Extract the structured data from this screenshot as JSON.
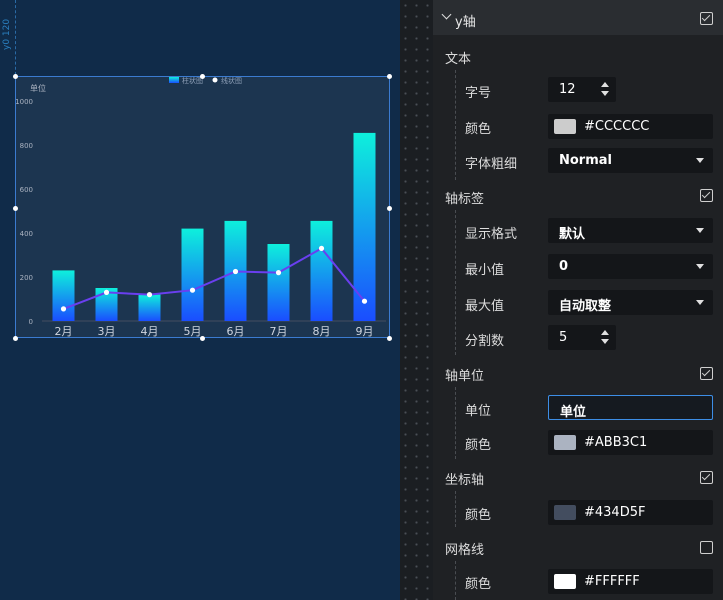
{
  "canvas": {
    "ruler_label": "y0 120"
  },
  "chart_data": {
    "type": "bar",
    "legend": [
      "柱状图",
      "线状图"
    ],
    "unit_label": "单位",
    "categories": [
      "2月",
      "3月",
      "4月",
      "5月",
      "6月",
      "7月",
      "8月",
      "9月"
    ],
    "series": [
      {
        "name": "柱状图",
        "type": "bar",
        "values": [
          230,
          150,
          120,
          420,
          455,
          350,
          455,
          855
        ]
      },
      {
        "name": "线状图",
        "type": "line",
        "values": [
          55,
          130,
          120,
          140,
          225,
          220,
          330,
          90
        ]
      }
    ],
    "yticks": [
      "0",
      "200",
      "400",
      "600",
      "800",
      "1000"
    ],
    "ylim": [
      0,
      1000
    ],
    "colors": {
      "bar_top": "#0ef0dc",
      "bar_bottom": "#1a4dff",
      "line": "#6a3ff0",
      "point": "#ffffff",
      "axis_text": "#ABB3C1"
    }
  },
  "panel": {
    "section_title": "y轴",
    "text_group": "文本",
    "font_size_label": "字号",
    "font_size_value": "12",
    "color_label": "颜色",
    "text_color": "#CCCCCC",
    "font_weight_label": "字体粗细",
    "font_weight_value": "Normal",
    "axis_label_group": "轴标签",
    "format_label": "显示格式",
    "format_value": "默认",
    "min_label": "最小值",
    "min_value": "0",
    "max_label": "最大值",
    "max_value": "自动取整",
    "split_label": "分割数",
    "split_value": "5",
    "unit_group": "轴单位",
    "unit_label": "单位",
    "unit_value": "单位",
    "unit_color": "#ABB3C1",
    "axis_group": "坐标轴",
    "axis_color": "#434D5F",
    "grid_group": "网格线",
    "grid_color": "#FFFFFF"
  }
}
